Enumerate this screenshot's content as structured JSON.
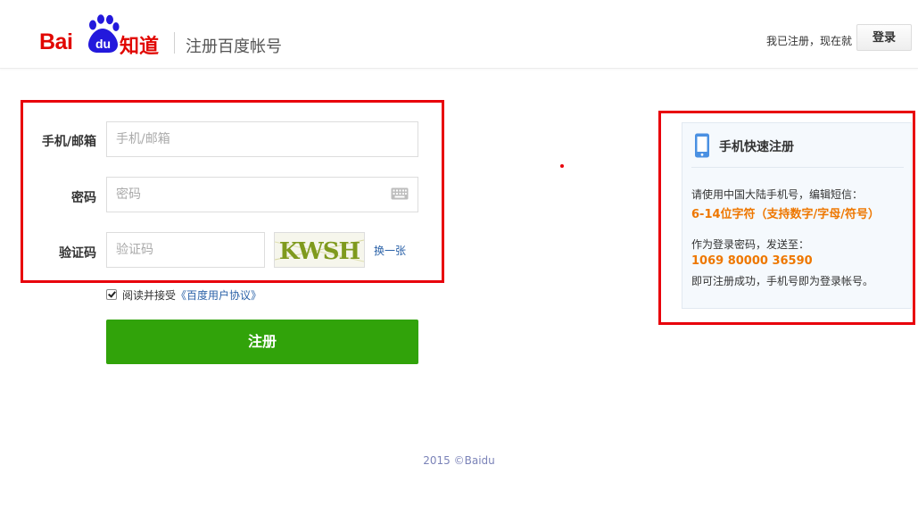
{
  "header": {
    "logo_bai": "Bai",
    "logo_du": "du",
    "logo_zhidao": "知道",
    "page_title": "注册百度帐号",
    "registered_text": "我已注册，现在就",
    "login_label": "登录"
  },
  "form": {
    "phone_label": "手机/邮箱",
    "phone_placeholder": "手机/邮箱",
    "password_label": "密码",
    "password_placeholder": "密码",
    "captcha_label": "验证码",
    "captcha_placeholder": "验证码",
    "captcha_text": "KWSH",
    "change_captcha": "换一张",
    "agree_prefix": "阅读并接受",
    "agree_link": "《百度用户协议》",
    "agree_checked": true,
    "register_label": "注册"
  },
  "sms_panel": {
    "title": "手机快速注册",
    "line1": "请使用中国大陆手机号，编辑短信：",
    "highlight1": "6-14位字符（支持数字/字母/符号）",
    "line2": "作为登录密码，发送至：",
    "highlight2": "1069 80000 36590",
    "line3": "即可注册成功，手机号即为登录帐号。"
  },
  "footer": {
    "copyright": "2015 ©Baidu"
  },
  "colors": {
    "brand_red": "#e10601",
    "register_green": "#31a30a",
    "link_blue": "#2b62a8",
    "highlight_orange": "#ee7700",
    "annotation_red": "#e8000b"
  },
  "icons": [
    "baidu-paw-icon",
    "keyboard-icon",
    "phone-icon",
    "checkbox-checked-icon"
  ]
}
